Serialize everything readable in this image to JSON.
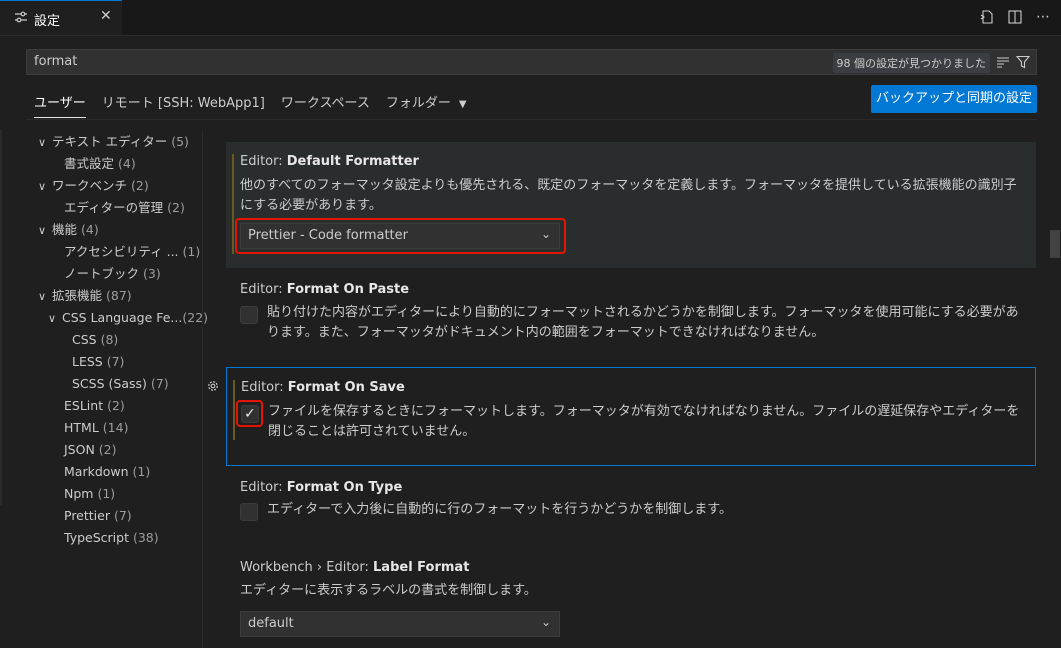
{
  "tab": {
    "title": "設定",
    "icon": "settings-sliders-icon",
    "close": "✕"
  },
  "search": {
    "value": "format",
    "count": "98 個の設定が見つかりました"
  },
  "scopes": [
    {
      "label": "ユーザー"
    },
    {
      "label": "リモート [SSH: WebApp1]"
    },
    {
      "label": "ワークスペース"
    },
    {
      "label": "フォルダー"
    }
  ],
  "sync_button": "バックアップと同期の設定",
  "toc": [
    {
      "label": "テキスト エディター",
      "count": "(5)",
      "expanded": true
    },
    {
      "label": "書式設定",
      "count": "(4)"
    },
    {
      "label": "ワークベンチ",
      "count": "(2)",
      "expanded": true
    },
    {
      "label": "エディターの管理",
      "count": "(2)"
    },
    {
      "label": "機能",
      "count": "(4)",
      "expanded": true
    },
    {
      "label": "アクセシビリティ ...",
      "count": "(1)"
    },
    {
      "label": "ノートブック",
      "count": "(3)"
    },
    {
      "label": "拡張機能",
      "count": "(87)",
      "expanded": true
    },
    {
      "label": "CSS Language Fe...",
      "count": "(22)",
      "expanded": true
    },
    {
      "label": "CSS",
      "count": "(8)"
    },
    {
      "label": "LESS",
      "count": "(7)"
    },
    {
      "label": "SCSS (Sass)",
      "count": "(7)"
    },
    {
      "label": "ESLint",
      "count": "(2)"
    },
    {
      "label": "HTML",
      "count": "(14)"
    },
    {
      "label": "JSON",
      "count": "(2)"
    },
    {
      "label": "Markdown",
      "count": "(1)"
    },
    {
      "label": "Npm",
      "count": "(1)"
    },
    {
      "label": "Prettier",
      "count": "(7)"
    },
    {
      "label": "TypeScript",
      "count": "(38)"
    }
  ],
  "settings": {
    "default_formatter": {
      "category": "Editor: ",
      "name": "Default Formatter",
      "desc1": "他のすべてのフォーマッタ設定よりも優先される、既定のフォーマッタを定義します。フォーマッタを提供している拡張機能の識別子",
      "desc2": "にする必要があります。",
      "value": "Prettier - Code formatter"
    },
    "format_on_paste": {
      "category": "Editor: ",
      "name": "Format On Paste",
      "desc1": "貼り付けた内容がエディターにより自動的にフォーマットされるかどうかを制御します。フォーマッタを使用可能にする必要があ",
      "desc2": "ります。また、フォーマッタがドキュメント内の範囲をフォーマットできなければなりません。",
      "checked": false
    },
    "format_on_save": {
      "category": "Editor: ",
      "name": "Format On Save",
      "desc1": "ファイルを保存するときにフォーマットします。フォーマッタが有効でなければなりません。ファイルの遅延保存やエディターを",
      "desc2": "閉じることは許可されていません。",
      "checked": true
    },
    "format_on_type": {
      "category": "Editor: ",
      "name": "Format On Type",
      "desc1": "エディターで入力後に自動的に行のフォーマットを行うかどうかを制御します。",
      "checked": false
    },
    "label_format": {
      "category": "Workbench › Editor: ",
      "name": "Label Format",
      "desc1": "エディターに表示するラベルの書式を制御します。",
      "value": "default"
    }
  }
}
